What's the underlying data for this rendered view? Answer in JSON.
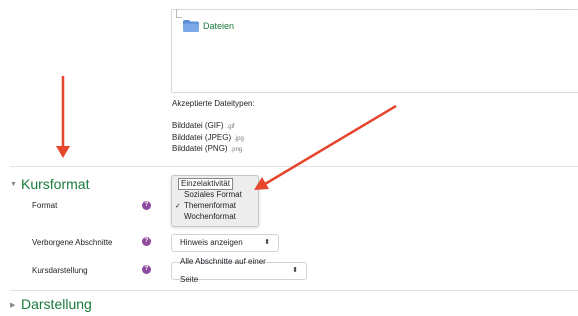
{
  "files": {
    "folder_label": "Dateien",
    "accepted_title": "Akzeptierte Dateitypen:",
    "types": [
      {
        "name": "Bilddatei (GIF)",
        "ext": ".gif"
      },
      {
        "name": "Bilddatei (JPEG)",
        "ext": ".jpg"
      },
      {
        "name": "Bilddatei (PNG)",
        "ext": ".png"
      }
    ]
  },
  "sections": {
    "kursformat": {
      "toggle": "▼",
      "title": "Kursformat"
    },
    "darstellung": {
      "toggle": "▶",
      "title": "Darstellung"
    }
  },
  "form": {
    "format": {
      "label": "Format",
      "options": [
        "Einzelaktivität",
        "Soziales Format",
        "Themenformat",
        "Wochenformat"
      ],
      "selected": "Themenformat",
      "check": "✓"
    },
    "hidden_sections": {
      "label": "Verborgene Abschnitte",
      "value": "Hinweis anzeigen",
      "arrow": "⬍"
    },
    "course_layout": {
      "label": "Kursdarstellung",
      "value": "Alle Abschnitte auf einer Seite",
      "arrow": "⬍"
    },
    "help_glyph": "?"
  },
  "colors": {
    "section_title": "#1a7a3a",
    "annotation_arrow": "#e6452e",
    "help_icon": "#8f4a9e"
  }
}
